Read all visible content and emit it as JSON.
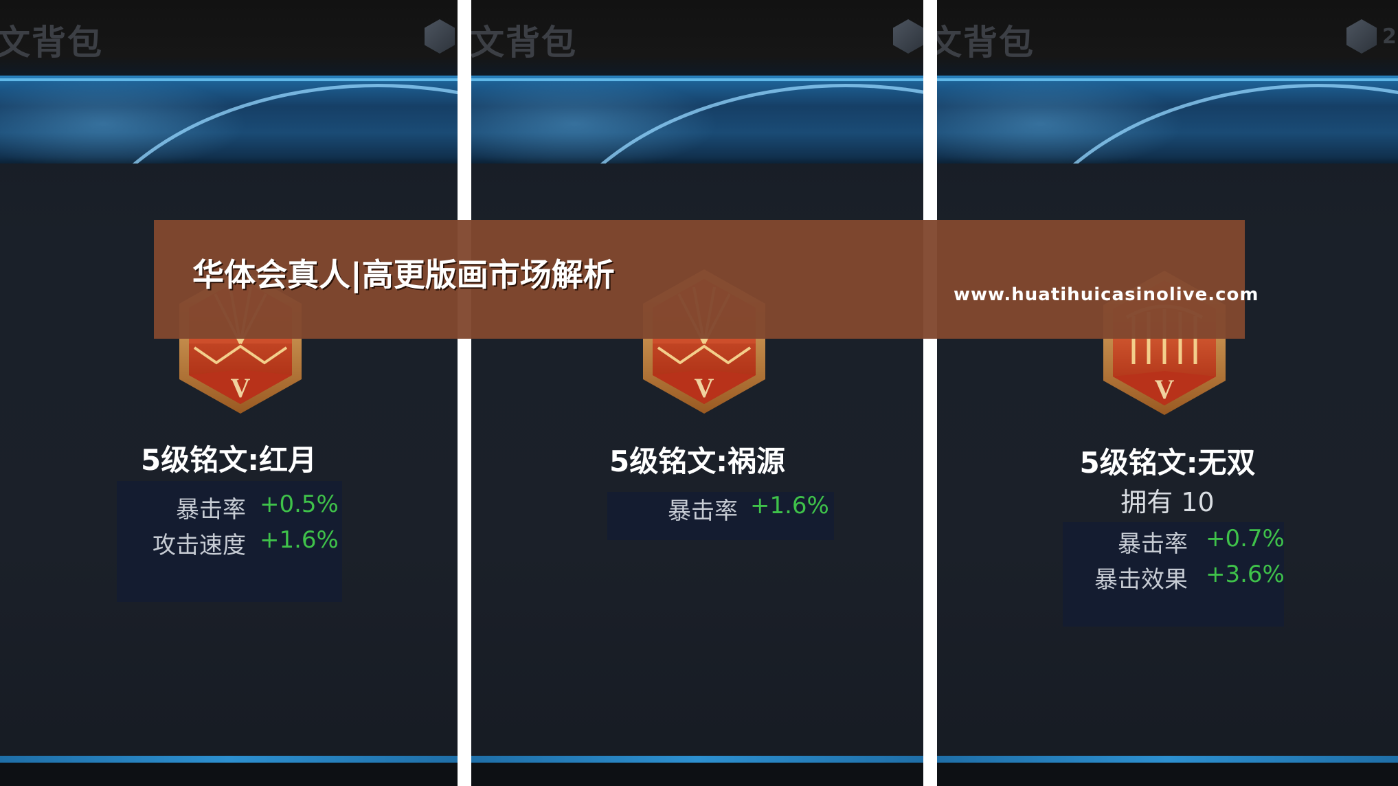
{
  "panels": [
    {
      "header_title": "文背包",
      "header_logo_text": "",
      "medal_icon": "medal-red-moon-icon",
      "title": "5级铭文:红月",
      "owned": "",
      "stats": [
        {
          "name": "暴击率",
          "value": "+0.5%"
        },
        {
          "name": "攻击速度",
          "value": "+1.6%"
        }
      ]
    },
    {
      "header_title": "文背包",
      "header_logo_text": "",
      "medal_icon": "medal-disaster-source-icon",
      "title": "5级铭文:祸源",
      "owned": "",
      "stats": [
        {
          "name": "暴击率",
          "value": "+1.6%"
        }
      ]
    },
    {
      "header_title": "文背包",
      "header_logo_text": "2",
      "medal_icon": "medal-unparalleled-icon",
      "title": "5级铭文:无双",
      "owned": "拥有 10",
      "stats": [
        {
          "name": "暴击率",
          "value": "+0.7%"
        },
        {
          "name": "暴击效果",
          "value": "+3.6%"
        }
      ]
    }
  ],
  "banner": {
    "title": "华体会真人|高更版画市场解析",
    "url": "www.huatihuicasinolive.com"
  },
  "colors": {
    "stat_value": "#3fc24a",
    "banner_bg": "#81482f",
    "medal_red": "#c8401f",
    "medal_gold": "#d89a4a"
  }
}
